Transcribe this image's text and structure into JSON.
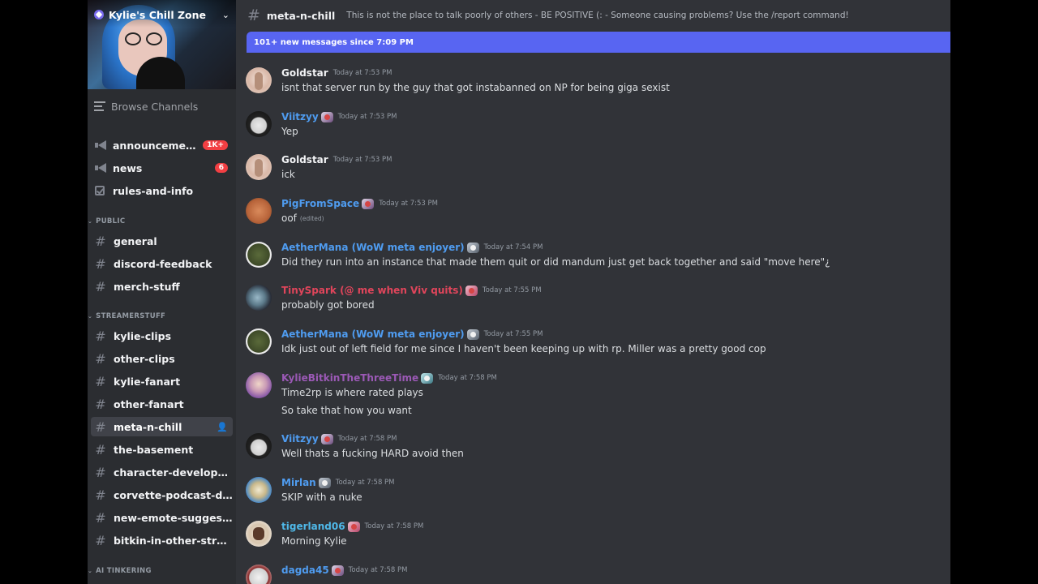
{
  "server": {
    "name": "Kylie's Chill Zone"
  },
  "sidebar": {
    "browse_label": "Browse Channels",
    "top_channels": [
      {
        "label": "announcements",
        "badge": "1K+",
        "icon": "megaphone-icon"
      },
      {
        "label": "news",
        "badge": "6",
        "icon": "megaphone-icon"
      },
      {
        "label": "rules-and-info",
        "icon": "rules-checkbox-icon"
      }
    ],
    "categories": [
      {
        "label": "PUBLIC",
        "channels": [
          "general",
          "discord-feedback",
          "merch-stuff"
        ]
      },
      {
        "label": "STREAMERSTUFF",
        "channels": [
          "kylie-clips",
          "other-clips",
          "kylie-fanart",
          "other-fanart",
          "meta-n-chill",
          "the-basement",
          "character-development",
          "corvette-podcast-discu...",
          "new-emote-suggestions",
          "bitkin-in-other-streams"
        ]
      },
      {
        "label": "AI TINKERING",
        "channels": []
      }
    ],
    "active_channel": "meta-n-chill"
  },
  "channel": {
    "name": "meta-n-chill",
    "topic": "This is not the place to talk poorly of others - BE POSITIVE (: - Someone causing problems? Use the /report command!"
  },
  "new_messages_bar": "101+ new messages since 7:09 PM",
  "messages": [
    {
      "author": "Goldstar",
      "author_color": "#f2f3f5",
      "timestamp": "Today at 7:53 PM",
      "lines": [
        "isnt that server run by the guy that got instabanned on NP for being giga sexist"
      ]
    },
    {
      "author": "Viitzyy",
      "author_color": "#4f9cf0",
      "role_icon": "anime-badge-icon",
      "timestamp": "Today at 7:53 PM",
      "lines": [
        "Yep"
      ]
    },
    {
      "author": "Goldstar",
      "author_color": "#f2f3f5",
      "timestamp": "Today at 7:53 PM",
      "lines": [
        "ick"
      ]
    },
    {
      "author": "PigFromSpace",
      "author_color": "#4f9cf0",
      "role_icon": "anime-badge-icon",
      "timestamp": "Today at 7:53 PM",
      "lines": [
        "oof"
      ],
      "edited": "(edited)"
    },
    {
      "author": "AetherMana (WoW meta enjoyer)",
      "author_color": "#4f9cf0",
      "role_icon": "gear-badge-icon",
      "timestamp": "Today at 7:54 PM",
      "lines": [
        "Did they run into an instance that made them quit or did mandum just get back together and said \"move here\"¿"
      ]
    },
    {
      "author": "TinySpark (@ me when Viv quits)",
      "author_color": "#e0455b",
      "role_icon": "pink-badge-icon",
      "timestamp": "Today at 7:55 PM",
      "lines": [
        "probably got bored"
      ]
    },
    {
      "author": "AetherMana (WoW meta enjoyer)",
      "author_color": "#4f9cf0",
      "role_icon": "gear-badge-icon",
      "timestamp": "Today at 7:55 PM",
      "lines": [
        "Idk just out of left field for me since I haven't been keeping up with rp. Miller was a pretty good cop"
      ]
    },
    {
      "author": "KylieBitkinTheThreeTime",
      "author_color": "#9b59b6",
      "role_icon": "teal-badge-icon",
      "timestamp": "Today at 7:58 PM",
      "lines": [
        "Time2rp is where rated plays",
        "So take that how you want"
      ]
    },
    {
      "author": "Viitzyy",
      "author_color": "#4f9cf0",
      "role_icon": "anime-badge-icon",
      "timestamp": "Today at 7:58 PM",
      "lines": [
        "Well thats a fucking HARD avoid then"
      ]
    },
    {
      "author": "Mirlan",
      "author_color": "#4f9cf0",
      "role_icon": "gear-badge-icon",
      "timestamp": "Today at 7:58 PM",
      "lines": [
        "SKIP with a nuke"
      ]
    },
    {
      "author": "tigerland06",
      "author_color": "#4fb8e8",
      "role_icon": "pink-badge-icon",
      "timestamp": "Today at 7:58 PM",
      "lines": [
        "Morning Kylie"
      ]
    },
    {
      "author": "dagda45",
      "author_color": "#4f9cf0",
      "role_icon": "anime-badge-icon",
      "timestamp": "Today at 7:58 PM",
      "lines": []
    }
  ]
}
